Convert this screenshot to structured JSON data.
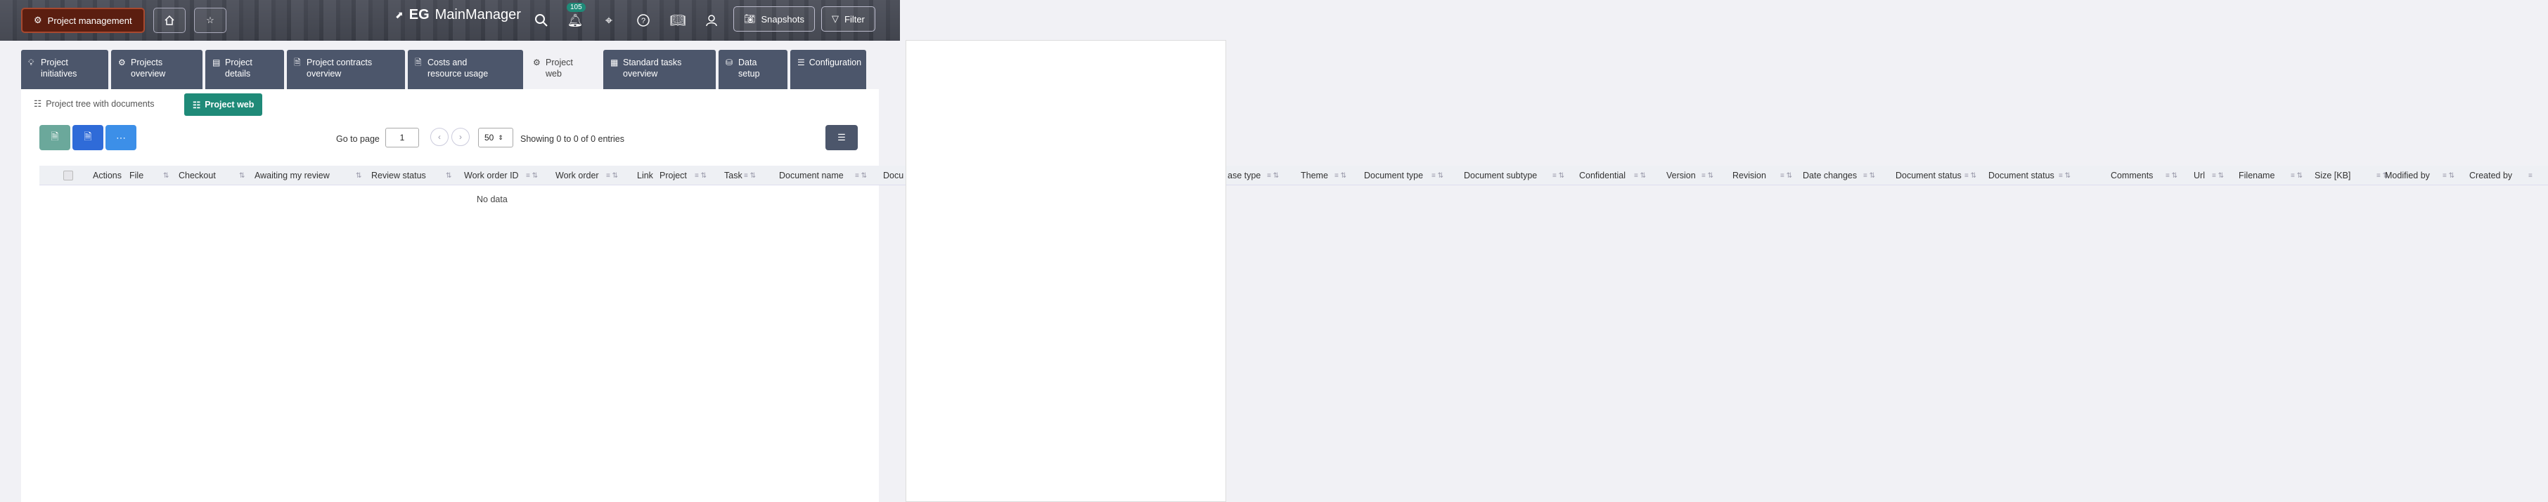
{
  "topbar": {
    "module_button": "Project management",
    "brand_prefix": "EG",
    "brand_name": "MainManager",
    "notification_count": "105",
    "snapshots_label": "Snapshots",
    "filter_label": "Filter"
  },
  "tabs": [
    {
      "line1": "Project",
      "line2": "initiatives",
      "icon": "bulb-icon"
    },
    {
      "line1": "Projects",
      "line2": "overview",
      "icon": "network-icon"
    },
    {
      "line1": "Project",
      "line2": "details",
      "icon": "details-icon"
    },
    {
      "line1": "Project contracts",
      "line2": "overview",
      "icon": "contract-icon"
    },
    {
      "line1": "Costs and",
      "line2": "resource usage",
      "icon": "document-icon"
    },
    {
      "line1": "Project",
      "line2": "web",
      "icon": "network-icon"
    },
    {
      "line1": "Standard tasks",
      "line2": "overview",
      "icon": "calendar-icon"
    },
    {
      "line1": "Data",
      "line2": "setup",
      "icon": "database-icon"
    },
    {
      "line1": "Configuration",
      "line2": "",
      "icon": "sliders-icon"
    }
  ],
  "subtabs": {
    "tree": "Project tree with documents",
    "web": "Project web"
  },
  "pager": {
    "goto_label": "Go to page",
    "page_value": "1",
    "page_size": "50",
    "showing": "Showing 0 to 0 of 0 entries"
  },
  "table": {
    "columns": [
      "Actions",
      "File",
      "Checkout",
      "Awaiting my review",
      "Review status",
      "Work order ID",
      "Work order",
      "Link",
      "Project",
      "Task",
      "Document name",
      "Docu",
      "ase type",
      "Theme",
      "Document type",
      "Document subtype",
      "Confidential",
      "Version",
      "Revision",
      "Date changes",
      "Document status",
      "Document status",
      "Comments",
      "Url",
      "Filename",
      "Size [KB]",
      "Modified by",
      "Created by"
    ],
    "empty_text": "No data"
  }
}
